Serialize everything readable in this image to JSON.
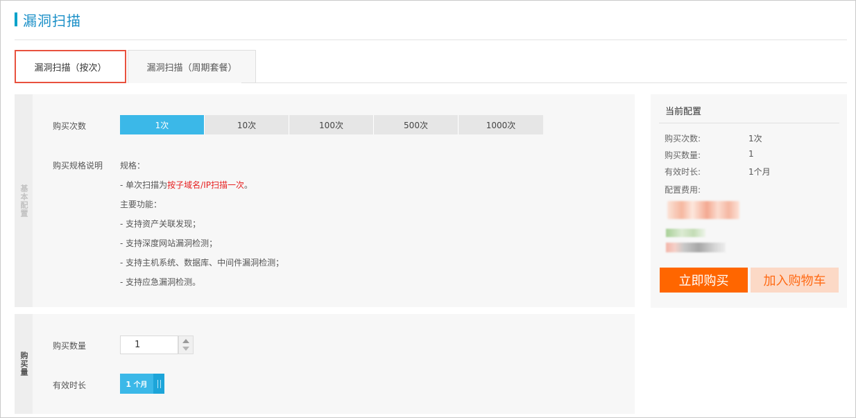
{
  "page": {
    "title": "漏洞扫描"
  },
  "tabs": [
    {
      "label": "漏洞扫描（按次）"
    },
    {
      "label": "漏洞扫描（周期套餐）"
    }
  ],
  "basic_config": {
    "side_label": "基本配置",
    "count_label": "购买次数",
    "count_options": [
      "1次",
      "10次",
      "100次",
      "500次",
      "1000次"
    ],
    "selected_count": "1次",
    "spec_label": "购买规格说明",
    "spec": {
      "heading": "规格：",
      "line1_prefix": "- 单次扫描为",
      "line1_highlight": "按子域名/IP扫描一次",
      "line1_suffix": "。",
      "features_heading": "主要功能：",
      "features": [
        "- 支持资产关联发现；",
        "- 支持深度网站漏洞检测；",
        "- 支持主机系统、数据库、中间件漏洞检测；",
        "- 支持应急漏洞检测。"
      ]
    }
  },
  "purchase_config": {
    "side_label": "购买量",
    "quantity_label": "购买数量",
    "quantity_value": "1",
    "duration_label": "有效时长",
    "duration_number": "1",
    "duration_unit": "个月"
  },
  "summary": {
    "title": "当前配置",
    "rows": [
      {
        "key": "购买次数:",
        "value": "1次"
      },
      {
        "key": "购买数量:",
        "value": "1"
      },
      {
        "key": "有效时长:",
        "value": "1个月"
      }
    ],
    "fee_label": "配置费用:",
    "buy_button": "立即购买",
    "cart_button": "加入购物车"
  },
  "colors": {
    "accent": "#3bb8e8",
    "title": "#1a8fc7",
    "buy": "#ff6600",
    "cart_bg": "#fcd9c6",
    "highlight": "#e61e1e",
    "tab_border": "#e8513e"
  }
}
